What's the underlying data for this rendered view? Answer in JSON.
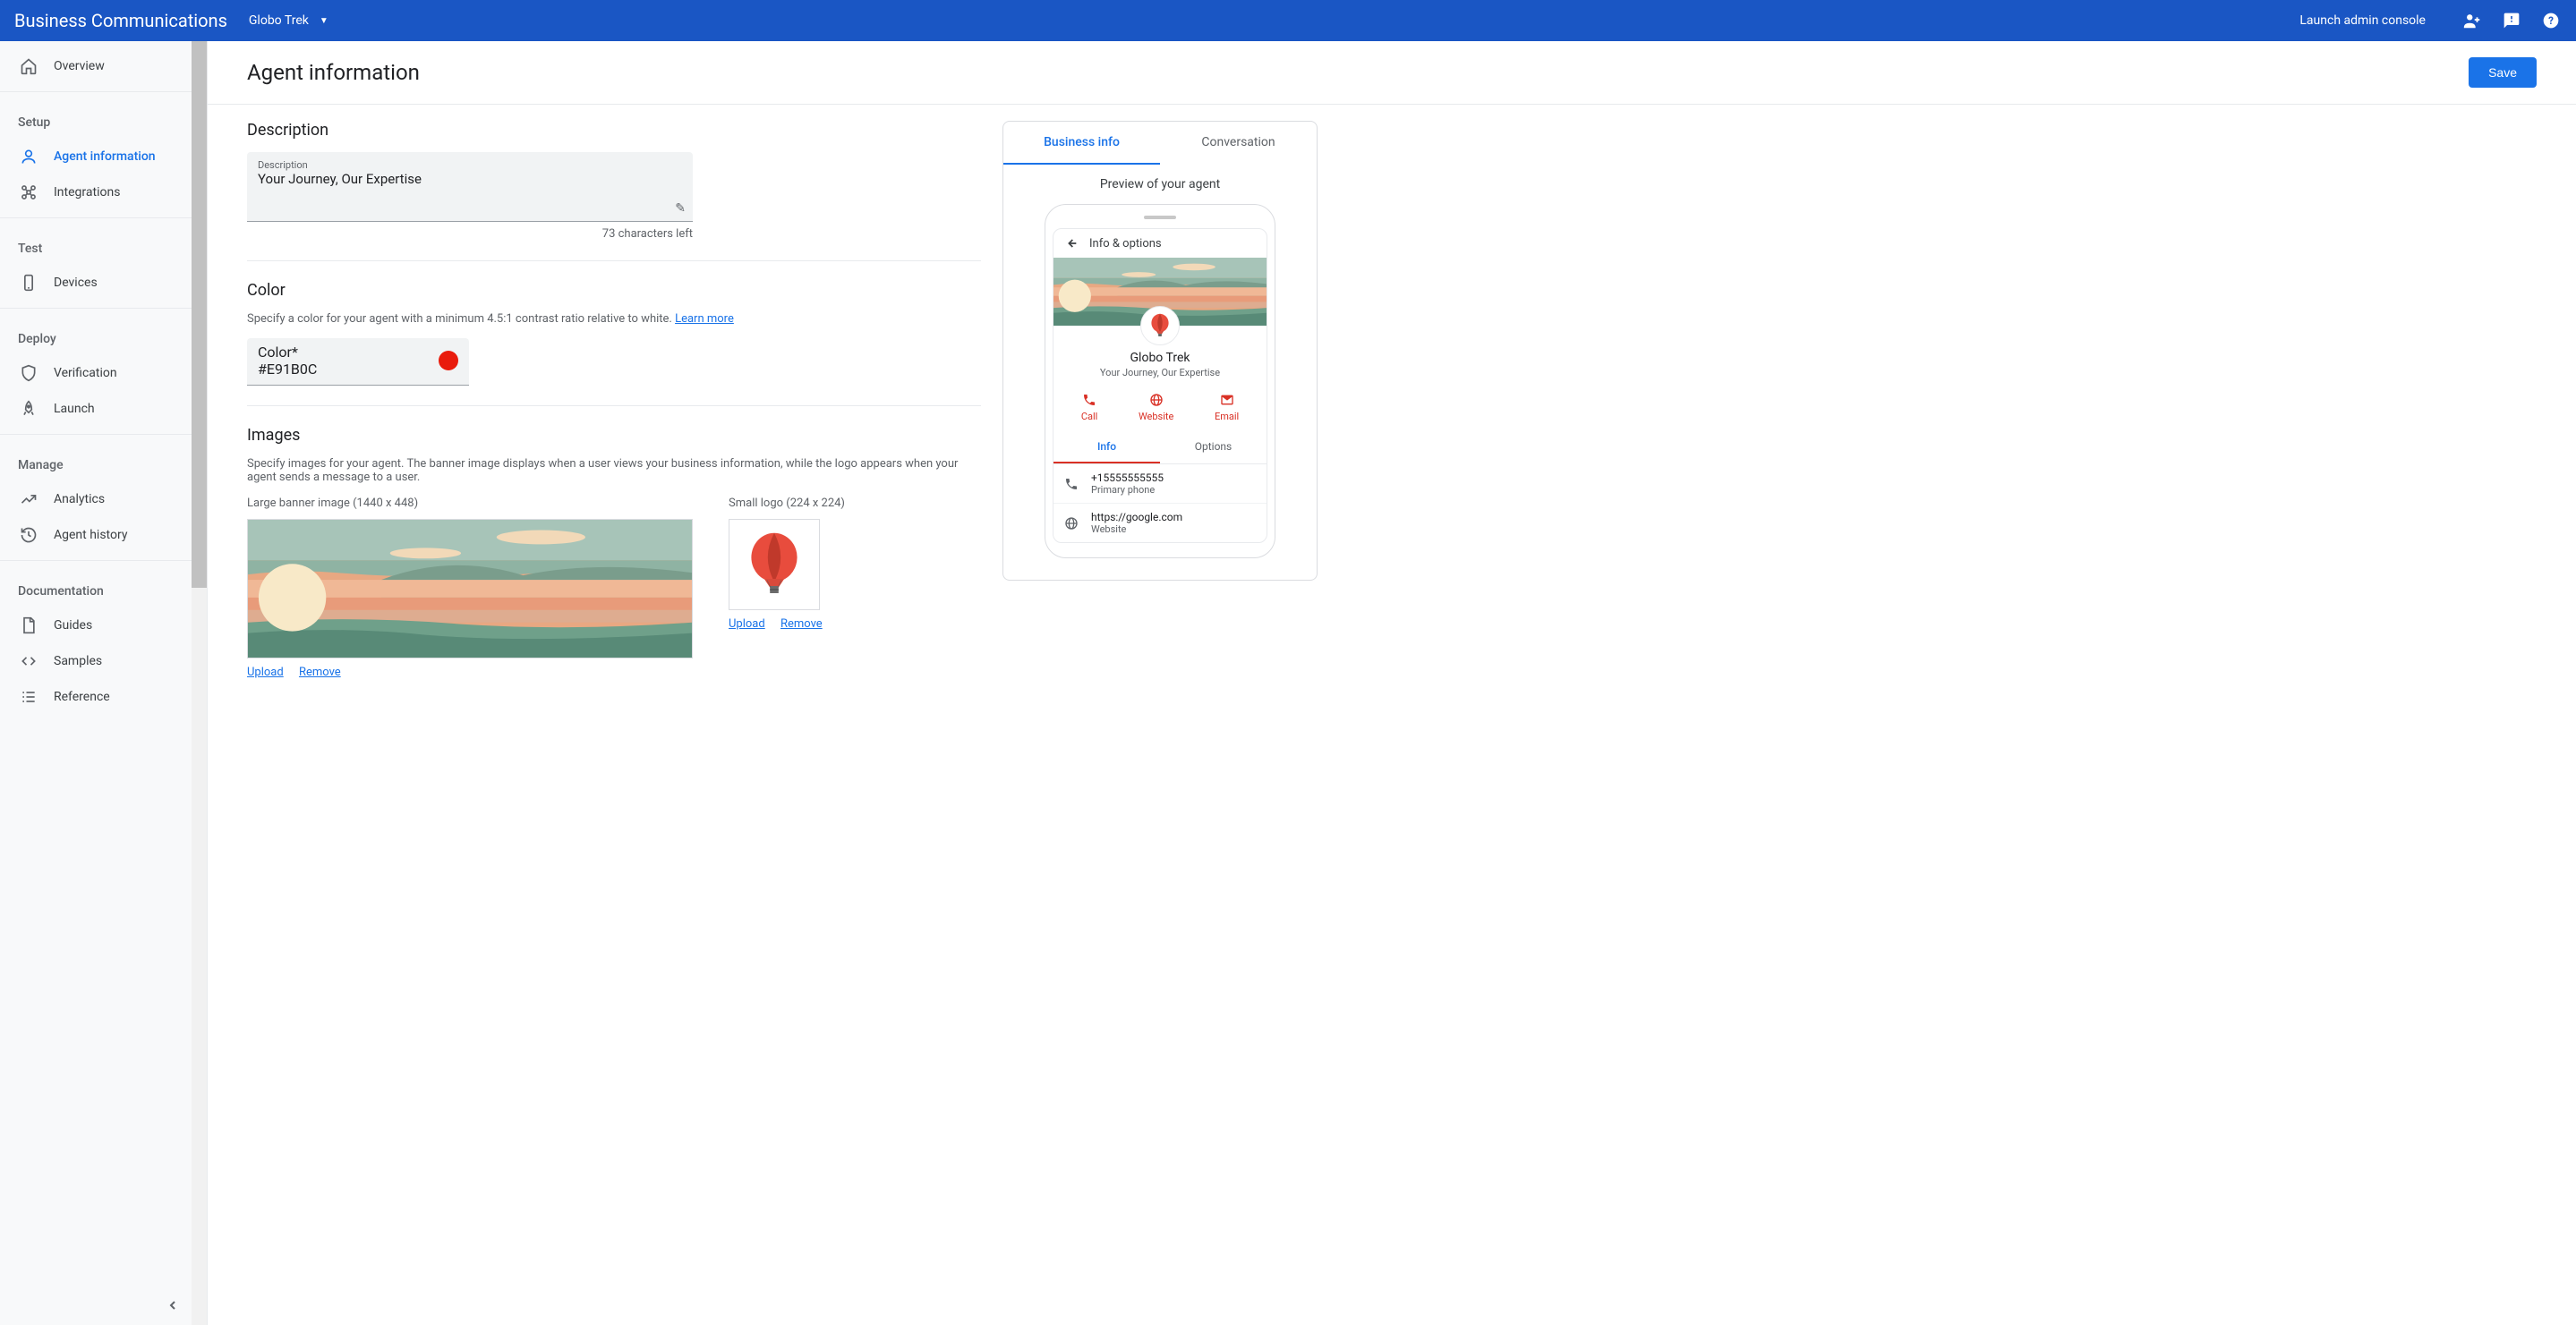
{
  "header": {
    "title": "Business Communications",
    "partner": "Globo Trek",
    "admin_link": "Launch admin console"
  },
  "sidebar": {
    "overview": "Overview",
    "section_setup": "Setup",
    "agent_info": "Agent information",
    "integrations": "Integrations",
    "section_test": "Test",
    "devices": "Devices",
    "section_deploy": "Deploy",
    "verification": "Verification",
    "launch": "Launch",
    "section_manage": "Manage",
    "analytics": "Analytics",
    "agent_history": "Agent history",
    "section_docs": "Documentation",
    "guides": "Guides",
    "samples": "Samples",
    "reference": "Reference"
  },
  "page": {
    "title": "Agent information",
    "save": "Save"
  },
  "description": {
    "heading": "Description",
    "label": "Description",
    "value": "Your Journey, Our Expertise",
    "chars_left": "73 characters left"
  },
  "color": {
    "heading": "Color",
    "help": "Specify a color for your agent with a minimum 4.5:1 contrast ratio relative to white. ",
    "learn_more": "Learn more",
    "label": "Color*",
    "value": "#E91B0C",
    "swatch": "#E91B0C"
  },
  "images": {
    "heading": "Images",
    "help": "Specify images for your agent. The banner image displays when a user views your business information, while the logo appears when your agent sends a message to a user.",
    "banner_label": "Large banner image (1440 x 448)",
    "logo_label": "Small logo (224 x 224)",
    "upload": "Upload",
    "remove": "Remove"
  },
  "preview": {
    "tab_business": "Business info",
    "tab_conversation": "Conversation",
    "caption": "Preview of your agent",
    "info_options": "Info & options",
    "agent_name": "Globo Trek",
    "tagline": "Your Journey, Our Expertise",
    "action_call": "Call",
    "action_website": "Website",
    "action_email": "Email",
    "subtab_info": "Info",
    "subtab_options": "Options",
    "phone_value": "+15555555555",
    "phone_label": "Primary phone",
    "website_value": "https://google.com",
    "website_label": "Website"
  }
}
